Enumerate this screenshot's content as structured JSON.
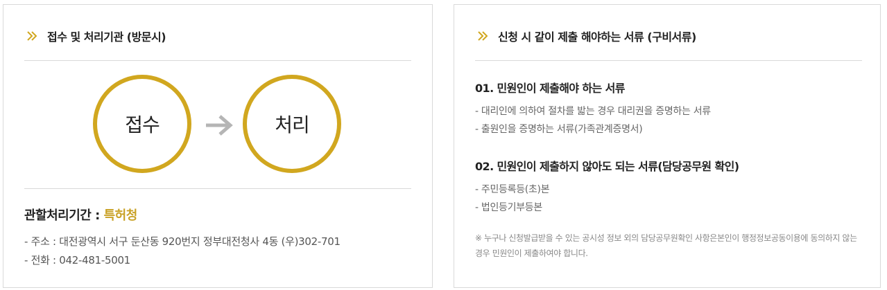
{
  "left_panel": {
    "title": "접수 및 처리기관 (방문시)",
    "icon": "double-chevron-right-icon",
    "step1": "접수",
    "step2": "처리",
    "agency_label": "관할처리기간 : ",
    "agency_name": "특허청",
    "address": "- 주소 : 대전광역시 서구 둔산동 920번지 정부대전청사 4동 (우)302-701",
    "phone": "- 전화 : 042-481-5001"
  },
  "right_panel": {
    "title": "신청 시 같이 제출 해야하는 서류 (구비서류)",
    "icon": "double-chevron-right-icon",
    "section1": {
      "heading": "01. 민원인이 제출해야 하는 서류",
      "items": [
        "- 대리인에 의하여 절차를 밟는 경우 대리권을 증명하는 서류",
        "- 출원인을 증명하는 서류(가족관계증명서)"
      ]
    },
    "section2": {
      "heading": "02. 민원인이 제출하지 않아도 되는 서류(담당공무원 확인)",
      "items": [
        "- 주민등록등(초)본",
        "- 법인등기부등본"
      ]
    },
    "note": "※ 누구나 신청발급받을 수 있는 공시성 정보 외의 담당공무원확인 사항은본인이 행정정보공동이용에 동의하지 않는 경우 민원인이 제출하여야 합니다."
  },
  "colors": {
    "accent_gold": "#d1a71f",
    "arrow_gray": "#b5b5b5",
    "border": "#d9d9d9"
  }
}
